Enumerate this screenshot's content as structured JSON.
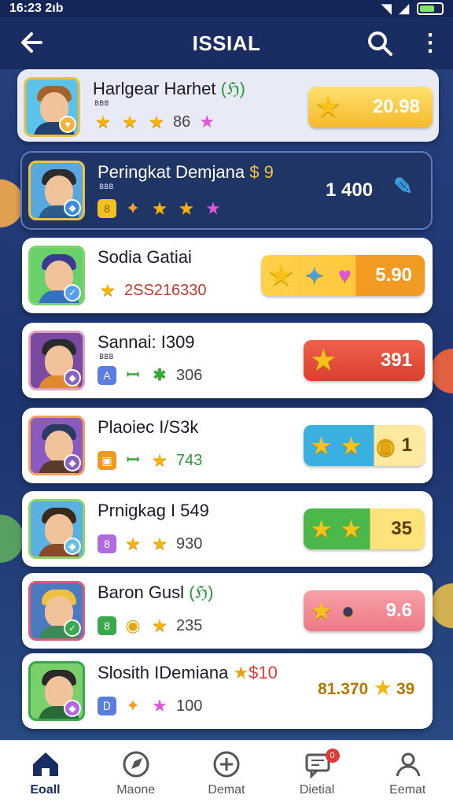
{
  "status": {
    "time": "16:23 2ıb"
  },
  "appbar": {
    "title": "ISSIAL"
  },
  "colors": {
    "primary": "#1a2d63",
    "highlight": "#1e3566",
    "gold": "#f5b50a"
  },
  "rows": [
    {
      "name": "Harlgear Harhet",
      "tag": "(ℌ)",
      "sub": "ꓐꓐꓐ",
      "value": "86",
      "score": "20.98",
      "score_style": "gold-pill"
    },
    {
      "name": "Peringkat Demjana",
      "tag": "$ 9",
      "sub": "ꓐꓐꓐ",
      "value": "",
      "score": "1 400",
      "score_style": "plain"
    },
    {
      "name": "Sodia Gatiai",
      "tag": "",
      "sub": "",
      "value": "2SS216330",
      "score": "5.90",
      "score_style": "orange-pill"
    },
    {
      "name": "Sannai: I309",
      "tag": "",
      "sub": "ꓐꓐꓐ",
      "value": "306",
      "score": "391",
      "score_style": "red-pill"
    },
    {
      "name": "Plaoiec I/S3k",
      "tag": "",
      "sub": "",
      "value": "743",
      "score": "1",
      "score_style": "blue-pill"
    },
    {
      "name": "Prnigkag I 549",
      "tag": "",
      "sub": "",
      "value": "930",
      "score": "35",
      "score_style": "green-pill"
    },
    {
      "name": "Baron Gusl",
      "tag": "(ℌ)",
      "sub": "",
      "value": "235",
      "score": "9.6",
      "score_style": "pink-pill"
    },
    {
      "name": "Slosith IDemiana",
      "tag": "$10",
      "sub": "",
      "value": "100",
      "score": "81.370",
      "score2": "39",
      "score_style": "plain-light"
    }
  ],
  "tabs": [
    {
      "label": "Eoall",
      "icon": "home-icon"
    },
    {
      "label": "Maone",
      "icon": "compass-icon"
    },
    {
      "label": "Demat",
      "icon": "plus-circle-icon"
    },
    {
      "label": "Dietial",
      "icon": "message-icon",
      "badge": "0"
    },
    {
      "label": "Eemat",
      "icon": "profile-icon"
    }
  ]
}
